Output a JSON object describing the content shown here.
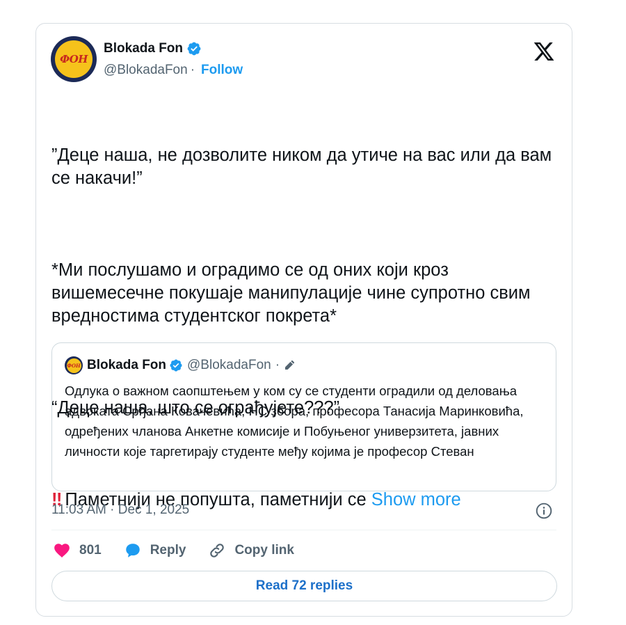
{
  "author": {
    "name": "Blokada Fon",
    "handle": "@BlokadaFon",
    "avatar_text": "ФОН",
    "separator": "·",
    "follow_label": "Follow"
  },
  "tweet": {
    "para1": "”Деце наша, не дозволите ником да утиче на вас или да вам се накачи!”",
    "para2": "*Ми послушамо и оградимо се од оних који кроз вишемесечне покушаје манипулације чине супротно свим вредностима студентског покрета*",
    "para3": "“Деце наша, што се ограђујете???”",
    "para4_emoji": "‼",
    "para4_text": "Паметнији не попушта, паметнији се ",
    "show_more": "Show more"
  },
  "quote": {
    "name": "Blokada Fon",
    "handle": "@BlokadaFon",
    "separator": "·",
    "text": "Одлука о важном саопштењем у ком су се студенти оградили од деловања адвоката Срђана Ковачевића, НС збора, професора Танасија Маринковића, одређених чланова Анкетне комисије и Побуњеног универзитета, јавних личности које таргетирају студенте међу којима је професор Стеван"
  },
  "meta": {
    "time": "11:03 AM",
    "separator": "·",
    "date": "Dec 1, 2025"
  },
  "actions": {
    "likes": "801",
    "reply_label": "Reply",
    "copy_label": "Copy link"
  },
  "read_replies_label": "Read 72 replies",
  "colors": {
    "accent": "#1d9bf0",
    "like": "#f91880",
    "text": "#0f1419",
    "muted": "#536471",
    "border": "#cfd9de"
  }
}
